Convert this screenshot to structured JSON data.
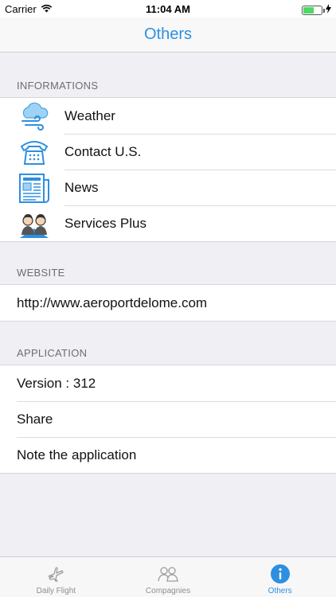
{
  "status_bar": {
    "carrier": "Carrier",
    "time": "11:04 AM",
    "wifi_icon": "wifi-icon",
    "battery_icon": "battery-icon",
    "charging_icon": "lightning-icon"
  },
  "nav": {
    "title": "Others"
  },
  "sections": {
    "informations": {
      "header": "INFORMATIONS",
      "items": [
        {
          "label": "Weather",
          "icon": "weather-icon"
        },
        {
          "label": "Contact U.S.",
          "icon": "telephone-icon"
        },
        {
          "label": "News",
          "icon": "newspaper-icon"
        },
        {
          "label": "Services Plus",
          "icon": "people-icon"
        }
      ]
    },
    "website": {
      "header": "WEBSITE",
      "url": "http://www.aeroportdelome.com"
    },
    "application": {
      "header": "APPLICATION",
      "items": [
        {
          "label": "Version : 312"
        },
        {
          "label": "Share"
        },
        {
          "label": "Note the application"
        }
      ]
    }
  },
  "tab_bar": {
    "tabs": [
      {
        "label": "Daily Flight",
        "icon": "airplane-icon",
        "active": false
      },
      {
        "label": "Compagnies",
        "icon": "people-group-icon",
        "active": false
      },
      {
        "label": "Others",
        "icon": "info-icon",
        "active": true
      }
    ]
  },
  "colors": {
    "accent": "#2e8fe0",
    "background": "#efeff4",
    "inactive_tab": "#8e8e93"
  }
}
